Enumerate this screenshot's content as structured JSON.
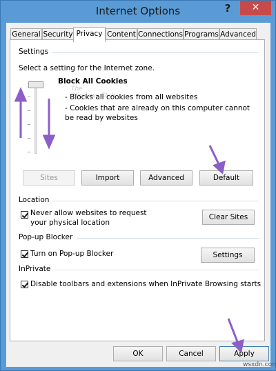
{
  "window": {
    "title": "Internet Options",
    "help_label": "?",
    "close_label": "✕"
  },
  "tabs": [
    {
      "label": "General",
      "active": false
    },
    {
      "label": "Security",
      "active": false
    },
    {
      "label": "Privacy",
      "active": true
    },
    {
      "label": "Content",
      "active": false
    },
    {
      "label": "Connections",
      "active": false
    },
    {
      "label": "Programs",
      "active": false
    },
    {
      "label": "Advanced",
      "active": false
    }
  ],
  "settings": {
    "group_label": "Settings",
    "instruction": "Select a setting for the Internet zone.",
    "level_title": "Block All Cookies",
    "level_desc_1": "- Blocks all cookies from all websites",
    "level_desc_2": "- Cookies that are already on this computer cannot be read by websites",
    "watermark_1": "The",
    "watermark_2": "Windows Club",
    "slider_level": 1.0,
    "buttons": {
      "sites": "Sites",
      "import": "Import",
      "advanced": "Advanced",
      "default": "Default"
    }
  },
  "location": {
    "group_label": "Location",
    "checkbox_label": "Never allow websites to request your physical location",
    "checked": true,
    "button": "Clear Sites"
  },
  "popup": {
    "group_label": "Pop-up Blocker",
    "checkbox_label": "Turn on Pop-up Blocker",
    "checked": true,
    "button": "Settings"
  },
  "inprivate": {
    "group_label": "InPrivate",
    "checkbox_label": "Disable toolbars and extensions when InPrivate Browsing starts",
    "checked": true
  },
  "footer": {
    "ok": "OK",
    "cancel": "Cancel",
    "apply": "Apply",
    "credit": "wsxdn.com"
  },
  "colors": {
    "titlebar": "#5b9bd5",
    "close": "#c74a4a",
    "annotation_arrow": "#8b5fc7"
  }
}
